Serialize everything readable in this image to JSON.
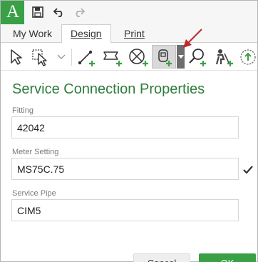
{
  "app": {
    "logo_letter": "A",
    "brand_color": "#3aa046",
    "quick_access": [
      "save-icon",
      "undo-icon",
      "redo-icon"
    ]
  },
  "tabs": [
    {
      "label": "My Work",
      "active": false
    },
    {
      "label": "Design",
      "active": true
    },
    {
      "label": "Print",
      "active": false
    }
  ],
  "toolbar": {
    "tools": [
      "select-arrow-icon",
      "select-dropdown-icon",
      "add-line-icon",
      "add-pipe-segment-icon",
      "add-valve-icon",
      "add-meter-icon",
      "add-search-marker-icon",
      "add-worker-icon",
      "add-upload-icon"
    ],
    "selected_tool": "add-meter-icon"
  },
  "dialog": {
    "title": "Service Connection Properties",
    "fields": [
      {
        "label": "Fitting",
        "value": "42042"
      },
      {
        "label": "Meter Setting",
        "value": "MS75C.75",
        "confirmed": true
      },
      {
        "label": "Service Pipe",
        "value": "CIM5"
      }
    ],
    "cancel_label": "Cancel",
    "ok_label": "OK"
  }
}
